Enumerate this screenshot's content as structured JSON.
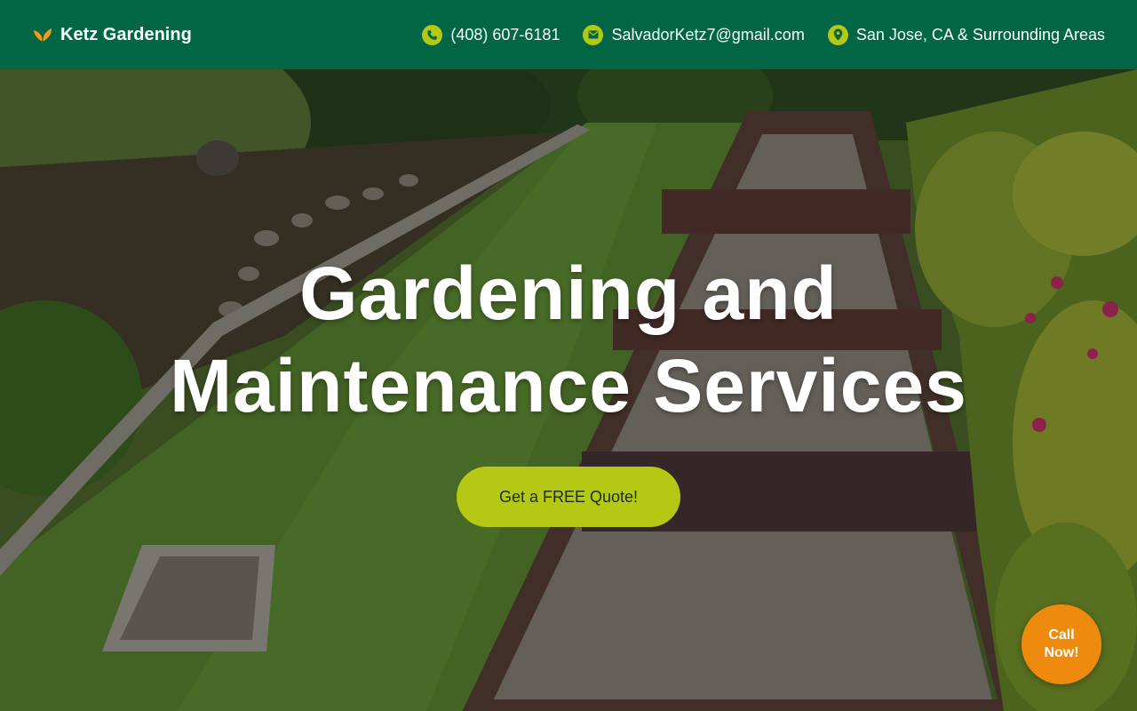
{
  "header": {
    "brand_name": "Ketz Gardening",
    "brand_icon": "leaf-icon",
    "phone": "(408) 607-6181",
    "phone_icon": "phone-icon",
    "email": "SalvadorKetz7@gmail.com",
    "email_icon": "mail-icon",
    "location": "San Jose, CA & Surrounding Areas",
    "location_icon": "location-pin-icon"
  },
  "hero": {
    "headline_line1": "Gardening and",
    "headline_line2": "Maintenance Services",
    "cta_label": "Get a FREE Quote!"
  },
  "floating": {
    "call_label": "Call Now!"
  },
  "colors": {
    "header_bg": "#006644",
    "accent": "#b5c814",
    "call_button": "#ee8a0e",
    "leaf": "#f39c12"
  }
}
